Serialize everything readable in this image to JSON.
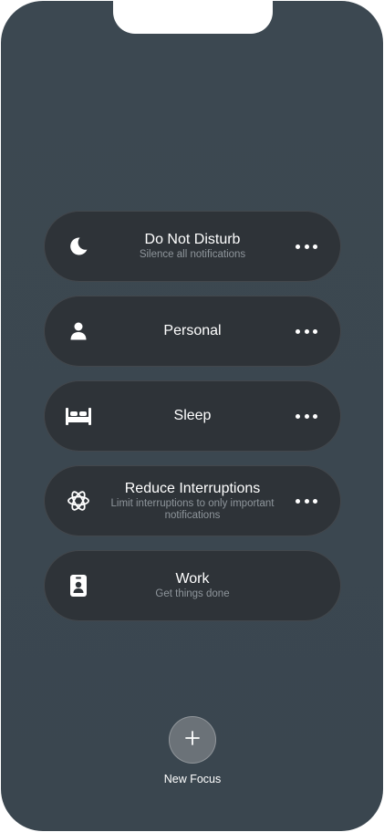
{
  "focus_modes": [
    {
      "id": "do-not-disturb",
      "title": "Do Not Disturb",
      "subtitle": "Silence all notifications",
      "icon": "moon-icon",
      "has_more": true
    },
    {
      "id": "personal",
      "title": "Personal",
      "subtitle": "",
      "icon": "person-icon",
      "has_more": true
    },
    {
      "id": "sleep",
      "title": "Sleep",
      "subtitle": "",
      "icon": "bed-icon",
      "has_more": true
    },
    {
      "id": "reduce-interruptions",
      "title": "Reduce Interruptions",
      "subtitle": "Limit interruptions to only important notifications",
      "icon": "atom-icon",
      "has_more": true
    },
    {
      "id": "work",
      "title": "Work",
      "subtitle": "Get things done",
      "icon": "id-badge-icon",
      "has_more": false
    }
  ],
  "new_focus": {
    "label": "New Focus",
    "icon": "plus-icon"
  },
  "colors": {
    "background": "#3b4750",
    "card": "#2e3338",
    "subtitle": "#8e959b",
    "add_button": "#6b7278"
  }
}
